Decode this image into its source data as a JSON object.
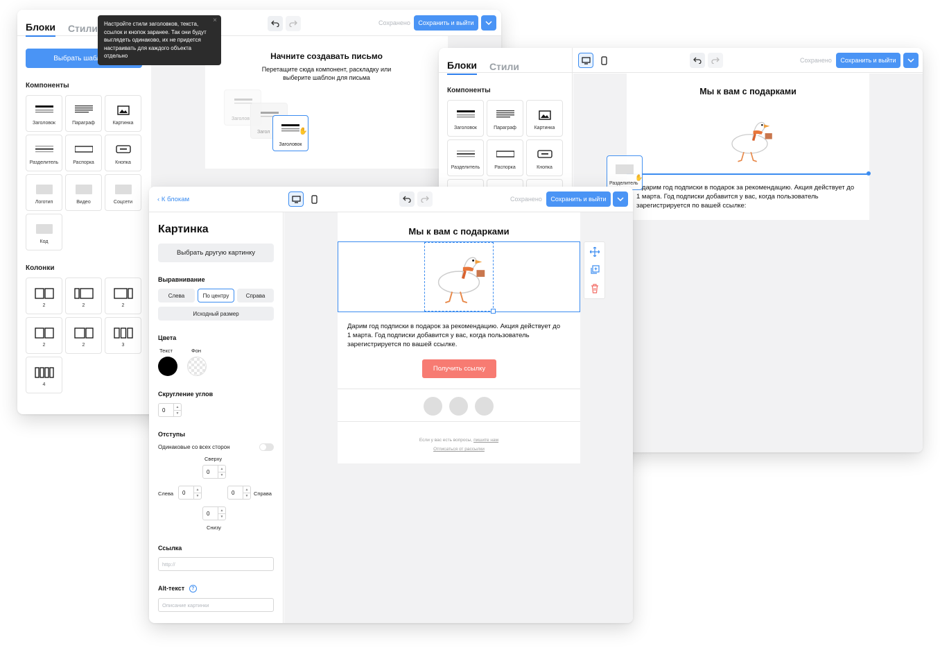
{
  "win1": {
    "tabs": [
      "Блоки",
      "Стили"
    ],
    "template_button": "Выбрать шаблон д",
    "tooltip": "Настройте стили заголовков, текста, ссылок и кнопок заранее. Так они будут выглядеть одинаково, их не придется настраивать для каждого объекта отдельно",
    "components_title": "Компоненты",
    "components": [
      "Заголовок",
      "Параграф",
      "Картинка",
      "Разделитель",
      "Распорка",
      "Кнопка",
      "Логотип",
      "Видео",
      "Соцсети",
      "Код"
    ],
    "columns_title": "Колонки",
    "columns": [
      "2",
      "2",
      "2",
      "2",
      "2",
      "3",
      "4"
    ],
    "saved": "Сохранено",
    "save_button": "Сохранить и выйти",
    "empty_title": "Начните создавать письмо",
    "empty_sub": "Перетащите сюда компонент, раскладку или выберите шаблон для письма",
    "ghost_labels": [
      "Заголов",
      "Загол",
      "Заголовок"
    ]
  },
  "win2": {
    "tabs": [
      "Блоки",
      "Стили"
    ],
    "components_title": "Компоненты",
    "components": [
      "Заголовок",
      "Параграф",
      "Картинка",
      "Разделитель",
      "Распорка",
      "Кнопка"
    ],
    "saved": "Сохранено",
    "save_button": "Сохранить и выйти",
    "email_title": "Мы к вам с подарками",
    "drag_label": "Разделитель",
    "email_text": "...дарим год подписки в подарок за рекомендацию. Акция действует до 1 марта. Год подписки добавится у вас, когда пользователь зарегистрируется по вашей ссылке:"
  },
  "win3": {
    "back": "К блокам",
    "saved": "Сохранено",
    "save_button": "Сохранить и выйти",
    "panel": {
      "title": "Картинка",
      "choose": "Выбрать другую картинку",
      "align_title": "Выравнивание",
      "align": [
        "Слева",
        "По центру",
        "Справа"
      ],
      "align_selected": "По центру",
      "original": "Исходный размер",
      "colors_title": "Цвета",
      "color_text": "Текст",
      "color_bg": "Фон",
      "text_color": "#000000",
      "radius_title": "Скругление углов",
      "radius": "0",
      "padding_title": "Отступы",
      "same_all": "Одинаковые со всех сторон",
      "top_label": "Сверху",
      "top": "0",
      "left_label": "Слева",
      "left": "0",
      "right_label": "Справа",
      "right": "0",
      "bottom_label": "Снизу",
      "bottom": "0",
      "link_title": "Ссылка",
      "link_placeholder": "http://",
      "alt_title": "Alt-текст",
      "alt_placeholder": "Описание картинки"
    },
    "email": {
      "title": "Мы к вам с подарками",
      "text": "Дарим год подписки в подарок за рекомендацию. Акция действует до 1 марта. Год подписки добавится у вас, когда пользователь зарегистрируется по вашей ссылке.",
      "cta": "Получить ссылку",
      "cta_color": "#f77b72",
      "footer_q": "Если у вас есть вопросы, ",
      "footer_link": "пишите нам",
      "unsubscribe": "Отписаться от рассылки"
    }
  },
  "colors": {
    "accent": "#4a94f5",
    "selection": "#3b8cf0"
  }
}
